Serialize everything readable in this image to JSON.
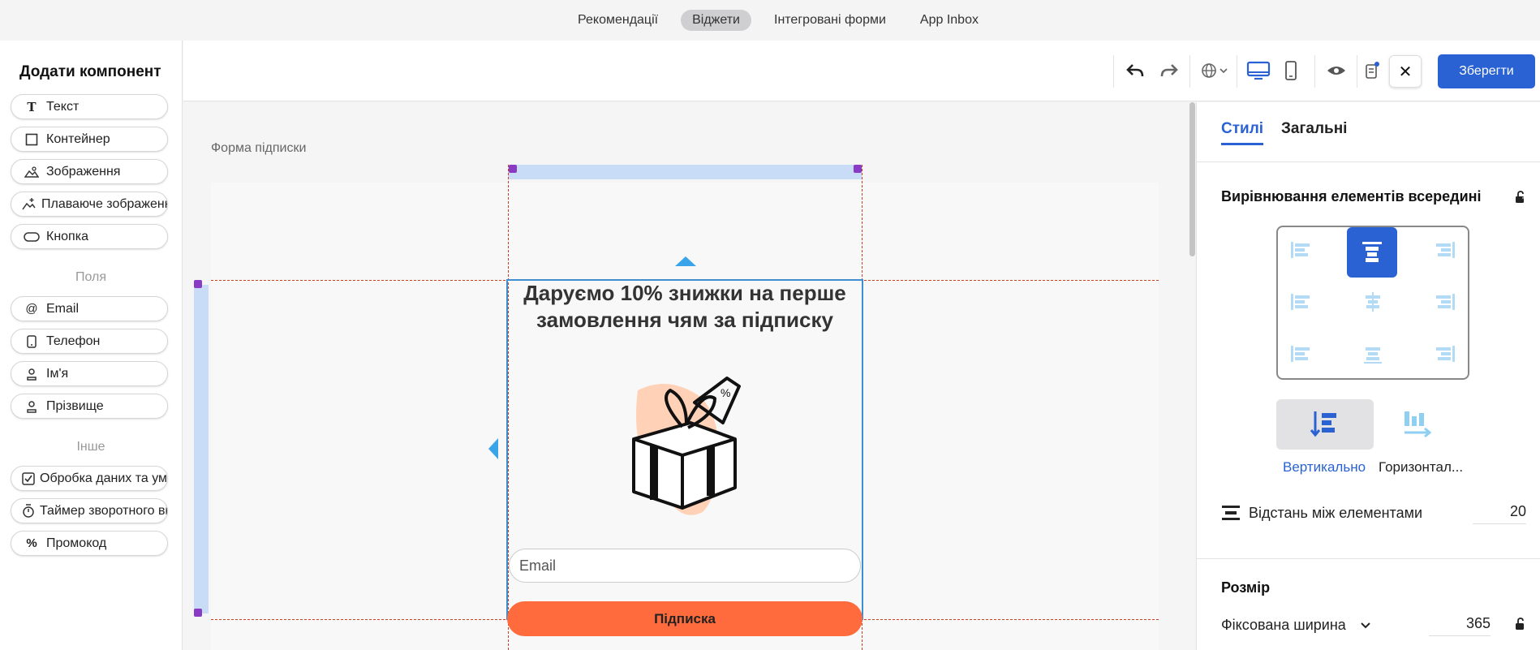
{
  "topnav": {
    "tabs": [
      {
        "label": "Рекомендації"
      },
      {
        "label": "Віджети",
        "active": true
      },
      {
        "label": "Інтегровані форми"
      },
      {
        "label": "App Inbox"
      }
    ]
  },
  "left": {
    "title": "Додати компонент",
    "components": [
      {
        "label": "Текст",
        "icon": "text-icon"
      },
      {
        "label": "Контейнер",
        "icon": "container-icon"
      },
      {
        "label": "Зображення",
        "icon": "image-icon"
      },
      {
        "label": "Плаваюче зображення",
        "icon": "floating-image-icon"
      },
      {
        "label": "Кнопка",
        "icon": "button-icon"
      }
    ],
    "fields_label": "Поля",
    "fields": [
      {
        "label": "Email",
        "icon": "at-icon"
      },
      {
        "label": "Телефон",
        "icon": "phone-icon"
      },
      {
        "label": "Ім'я",
        "icon": "person-icon"
      },
      {
        "label": "Прізвище",
        "icon": "person-icon"
      }
    ],
    "other_label": "Інше",
    "other": [
      {
        "label": "Обробка даних та умови",
        "icon": "checkbox-icon"
      },
      {
        "label": "Таймер зворотного відліку",
        "icon": "timer-icon"
      },
      {
        "label": "Промокод",
        "icon": "percent-icon"
      }
    ]
  },
  "toolbar": {
    "save_label": "Зберегти",
    "close_label": "✕"
  },
  "canvas": {
    "form_label": "Форма підписки",
    "headline": "Даруємо 10% знижки на перше замовлення чям за підписку",
    "email_placeholder": "Email",
    "subscribe_label": "Підписка"
  },
  "right": {
    "tab_styles": "Стилі",
    "tab_general": "Загальні",
    "align_title": "Вирівнювання елементів всередині",
    "direction_vertical": "Вертикально",
    "direction_horizontal": "Горизонтал...",
    "spacing_label": "Відстань між елементами",
    "spacing_value": "20",
    "size_title": "Розмір",
    "width_mode": "Фіксована ширина",
    "width_value": "365"
  },
  "colors": {
    "accent": "#2a62d4",
    "button": "#ff6b3d",
    "selection": "#c9dcf7"
  }
}
